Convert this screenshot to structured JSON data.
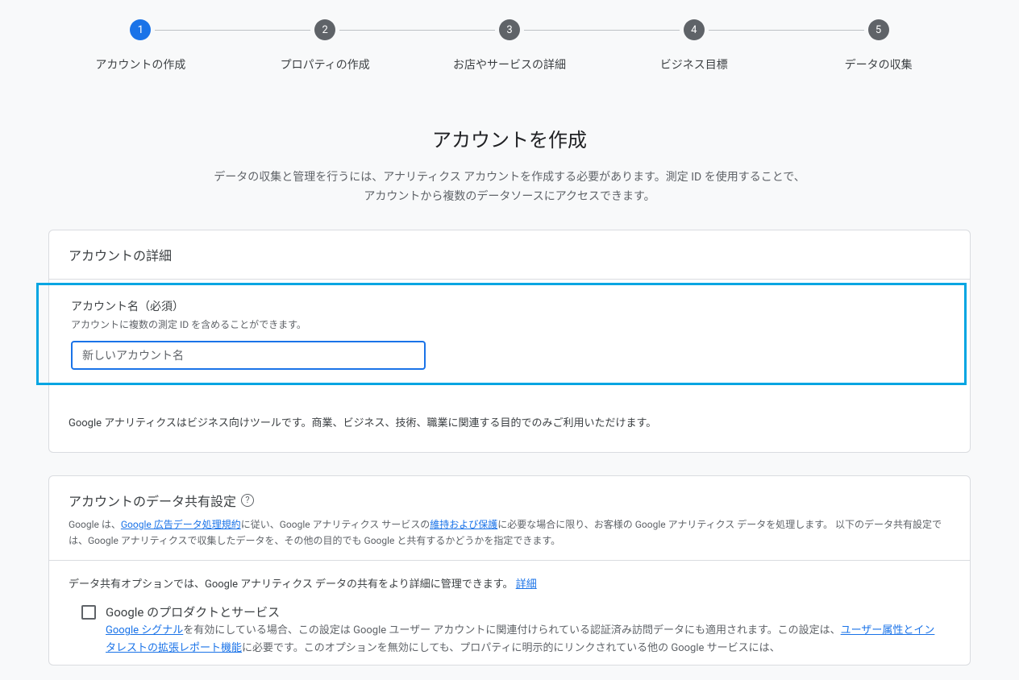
{
  "stepper": {
    "steps": [
      {
        "num": "1",
        "label": "アカウントの作成"
      },
      {
        "num": "2",
        "label": "プロパティの作成"
      },
      {
        "num": "3",
        "label": "お店やサービスの詳細"
      },
      {
        "num": "4",
        "label": "ビジネス目標"
      },
      {
        "num": "5",
        "label": "データの収集"
      }
    ]
  },
  "page": {
    "title": "アカウントを作成",
    "subtitle": "データの収集と管理を行うには、アナリティクス アカウントを作成する必要があります。測定 ID を使用することで、アカウントから複数のデータソースにアクセスできます。"
  },
  "details": {
    "header": "アカウントの詳細",
    "field_label": "アカウント名（必須）",
    "field_hint": "アカウントに複数の測定 ID を含めることができます。",
    "placeholder": "新しいアカウント名",
    "usage_note": "Google アナリティクスはビジネス向けツールです。商業、ビジネス、技術、職業に関連する目的でのみご利用いただけます。"
  },
  "sharing": {
    "header": "アカウントのデータ共有設定",
    "policy_pre": "Google は、",
    "policy_link1": "Google 広告データ処理規約",
    "policy_mid1": "に従い、Google アナリティクス サービスの",
    "policy_link2": "維持および保護",
    "policy_post": "に必要な場合に限り、お客様の Google アナリティクス データを処理します。 以下のデータ共有設定では、Google アナリティクスで収集したデータを、その他の目的でも Google と共有するかどうかを指定できます。",
    "opt_line_pre": "データ共有オプションでは、Google アナリティクス データの共有をより詳細に管理できます。 ",
    "opt_line_link": "詳細",
    "checkbox1": {
      "title": "Google のプロダクトとサービス",
      "desc_link1": "Google シグナル",
      "desc_mid": "を有効にしている場合、この設定は Google ユーザー アカウントに関連付けられている認証済み訪問データにも適用されます。この設定は、",
      "desc_link2": "ユーザー属性とインタレストの拡張レポート機能",
      "desc_post": "に必要です。このオプションを無効にしても、プロパティに明示的にリンクされている他の Google サービスには、"
    }
  }
}
